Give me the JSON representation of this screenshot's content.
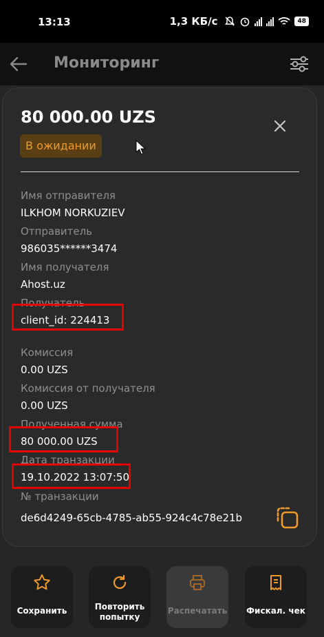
{
  "status_bar": {
    "time": "13:13",
    "speed": "1,3 КБ/с",
    "battery": "48"
  },
  "header": {
    "title": "Мониторинг"
  },
  "transaction": {
    "amount": "80 000.00 UZS",
    "status": "В ожидании",
    "fields": [
      {
        "label": "Имя отправителя",
        "value": "ILKHOM NORKUZIEV"
      },
      {
        "label": "Отправитель",
        "value": "986035******3474"
      },
      {
        "label": "Имя получателя",
        "value": "Ahost.uz"
      },
      {
        "label": "Получатель",
        "value": "client_id: 224413"
      },
      {
        "label": "Комиссия",
        "value": "0.00 UZS"
      },
      {
        "label": "Комиссия от получателя",
        "value": "0.00 UZS"
      },
      {
        "label": "Полученная сумма",
        "value": "80 000.00 UZS"
      },
      {
        "label": "Дата транзакции",
        "value": "19.10.2022 13:07:50"
      },
      {
        "label": "№ транзакции",
        "value": "de6d4249-65cb-4785-ab55-924c4c78e21b"
      }
    ]
  },
  "actions": {
    "save": "Сохранить",
    "retry_line1": "Повторить",
    "retry_line2": "попытку",
    "print": "Распечатать",
    "fiscal": "Фискал. чек"
  },
  "colors": {
    "accent": "#f09a2a",
    "badge_bg": "#5a3f14",
    "highlight": "#e60000"
  }
}
